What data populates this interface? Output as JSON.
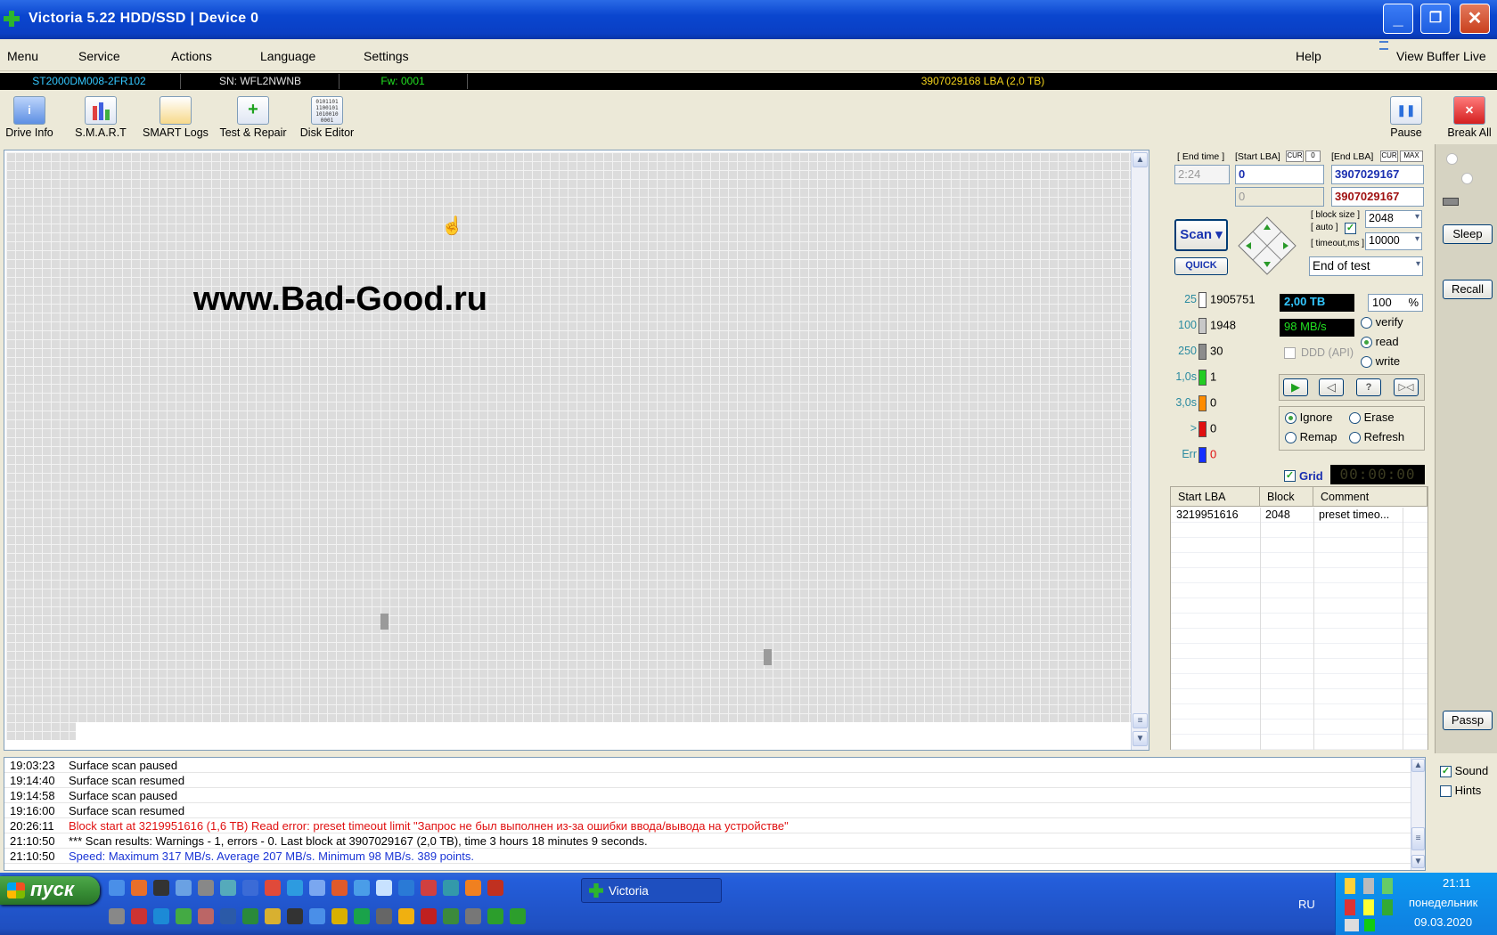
{
  "window": {
    "title": "Victoria 5.22 HDD/SSD | Device 0"
  },
  "menu": {
    "items": [
      "Menu",
      "Service",
      "Actions",
      "Language",
      "Settings"
    ],
    "help": "Help",
    "view_buffer": "View Buffer Live"
  },
  "drive": {
    "model": "ST2000DM008-2FR102",
    "serial": "SN: WFL2NWNB",
    "firmware": "Fw: 0001",
    "capacity": "3907029168 LBA (2,0 TB)"
  },
  "toolbar": {
    "drive_info": "Drive Info",
    "smart": "S.M.A.R.T",
    "smart_logs": "SMART Logs",
    "test_repair": "Test & Repair",
    "disk_editor": "Disk Editor",
    "pause": "Pause",
    "break_all": "Break All"
  },
  "watermark": "www.Bad-Good.ru",
  "scan": {
    "end_time_label": "[ End time ]",
    "start_lba_label": "[Start LBA]",
    "end_lba_label": "[End LBA]",
    "cur_label": "CUR",
    "zero_label": "0",
    "max_label": "MAX",
    "end_time": "2:24",
    "start_lba": "0",
    "end_lba": "3907029167",
    "start_lba_cur": "0",
    "end_lba_cur": "3907029167",
    "scan_button": "Scan",
    "quick_button": "QUICK",
    "block_size_label": "[ block size ]",
    "auto_label": "[ auto ]",
    "block_size": "2048",
    "timeout_label": "[ timeout,ms ]",
    "timeout": "10000",
    "end_action": "End of test"
  },
  "stats": {
    "capacity_done": "2,00 TB",
    "percent": "100",
    "percent_sign": "%",
    "speed": "98 MB/s",
    "ddd_label": "DDD (API)",
    "modes": {
      "verify": "verify",
      "read": "read",
      "write": "write"
    },
    "legend": [
      {
        "label": "25",
        "count": "1905751",
        "color": "#ffffff",
        "label_color": "#2a8aa0"
      },
      {
        "label": "100",
        "count": "1948",
        "color": "#c8c8c8",
        "label_color": "#2a8aa0"
      },
      {
        "label": "250",
        "count": "30",
        "color": "#8c8c8c",
        "label_color": "#2a8aa0"
      },
      {
        "label": "1,0s",
        "count": "1",
        "color": "#22cc22",
        "label_color": "#2a8aa0"
      },
      {
        "label": "3,0s",
        "count": "0",
        "color": "#ff8c00",
        "label_color": "#2a8aa0"
      },
      {
        "label": ">",
        "count": "0",
        "color": "#e01010",
        "label_color": "#2a8aa0"
      },
      {
        "label": "Err",
        "count": "0",
        "color": "#1530ff",
        "label_color": "#2a8aa0"
      }
    ],
    "actions": {
      "ignore": "Ignore",
      "erase": "Erase",
      "remap": "Remap",
      "refresh": "Refresh"
    },
    "grid_label": "Grid",
    "timer": "00:00:00"
  },
  "side": {
    "sleep": "Sleep",
    "recall": "Recall",
    "passp": "Passp",
    "sound": "Sound",
    "hints": "Hints"
  },
  "table": {
    "headers": [
      "Start LBA",
      "Block",
      "Comment"
    ],
    "rows": [
      [
        "3219951616",
        "2048",
        "preset timeo..."
      ]
    ]
  },
  "log": [
    {
      "time": "19:03:23",
      "msg": "Surface scan paused",
      "color": "#000000"
    },
    {
      "time": "19:14:40",
      "msg": "Surface scan resumed",
      "color": "#000000"
    },
    {
      "time": "19:14:58",
      "msg": "Surface scan paused",
      "color": "#000000"
    },
    {
      "time": "19:16:00",
      "msg": "Surface scan resumed",
      "color": "#000000"
    },
    {
      "time": "20:26:11",
      "msg": "Block start at 3219951616 (1,6 TB) Read error: preset timeout limit \"Запрос не был выполнен из-за ошибки ввода/вывода на устройстве\"",
      "color": "#e01010"
    },
    {
      "time": "21:10:50",
      "msg": "*** Scan results: Warnings - 1, errors - 0. Last block at 3907029167 (2,0 TB), time 3 hours 18 minutes 9 seconds.",
      "color": "#000000"
    },
    {
      "time": "21:10:50",
      "msg": "Speed: Maximum 317 MB/s. Average 207 MB/s. Minimum 98 MB/s. 389 points.",
      "color": "#1a35d6"
    }
  ],
  "taskbar": {
    "start": "пуск",
    "app": "Victoria",
    "lang": "RU",
    "time": "21:11",
    "day": "понедельник",
    "date": "09.03.2020"
  }
}
